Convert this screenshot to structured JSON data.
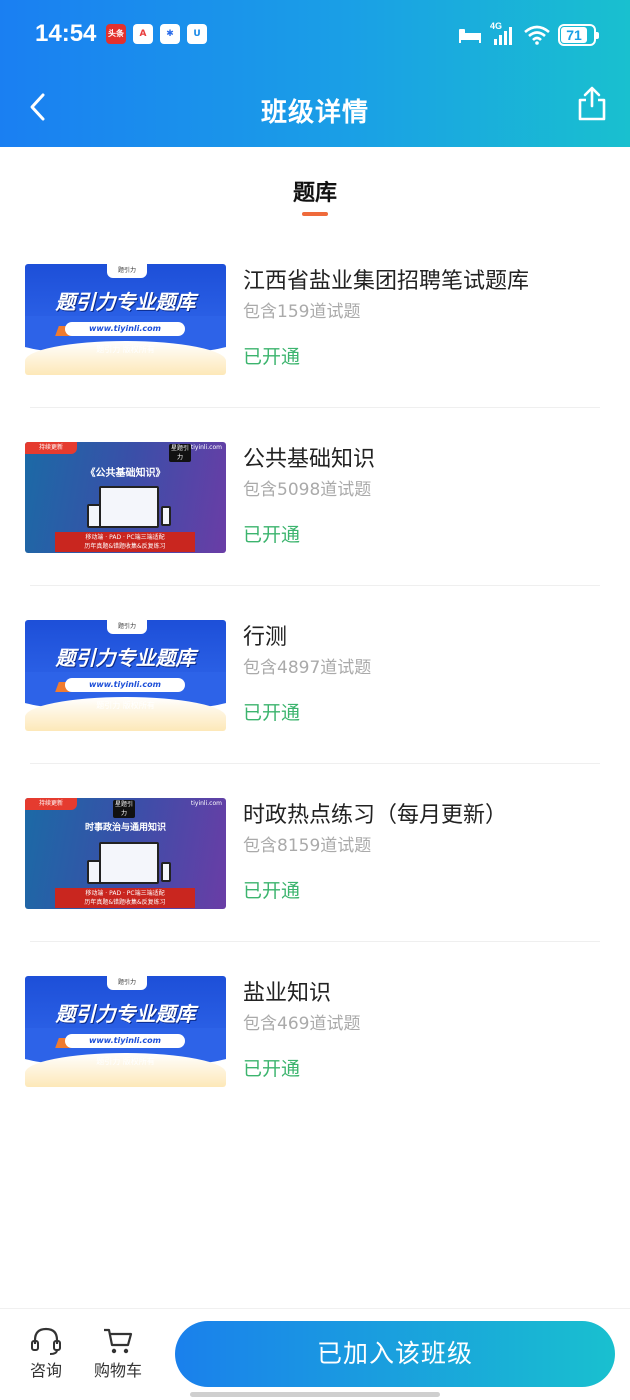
{
  "status_bar": {
    "time": "14:54",
    "app_icons": [
      "toutiao-icon",
      "app-a-icon",
      "app-cube-icon",
      "app-u-icon"
    ],
    "app_labels": [
      "头条",
      "A",
      "✱",
      "U"
    ],
    "network": "4G",
    "battery": "71"
  },
  "nav": {
    "title": "班级详情",
    "back_icon": "chevron-left-icon",
    "share_icon": "share-icon"
  },
  "tabs": [
    {
      "label": "题库",
      "active": true
    }
  ],
  "items": [
    {
      "thumb": "blue",
      "thumb_text": {
        "logo": "题引力",
        "main": "题引力专业题库",
        "url": "www.tiyinli.com",
        "copy": "题引力 版权所有"
      },
      "name": "江西省盐业集团招聘笔试题库",
      "count": "包含159道试题",
      "status": "已开通"
    },
    {
      "thumb": "purple",
      "thumb_text": {
        "tag": "持续更新",
        "brand": "tiyinli.com",
        "badge": "星题引力",
        "heading": "《公共基础知识》",
        "box_line1": "移动端 · PAD · PC端三端适配",
        "box_line2": "历年真题&错题收集&反复练习"
      },
      "name": "公共基础知识",
      "count": "包含5098道试题",
      "status": "已开通"
    },
    {
      "thumb": "blue",
      "thumb_text": {
        "logo": "题引力",
        "main": "题引力专业题库",
        "url": "www.tiyinli.com",
        "copy": "题引力 版权所有"
      },
      "name": "行测",
      "count": "包含4897道试题",
      "status": "已开通"
    },
    {
      "thumb": "purple",
      "thumb_text": {
        "tag": "持续更新",
        "brand": "tiyinli.com",
        "badge": "星题引力",
        "heading": "时事政治与通用知识",
        "box_line1": "移动端 · PAD · PC端三端适配",
        "box_line2": "历年真题&错题收集&反复练习"
      },
      "name": "时政热点练习（每月更新）",
      "count": "包含8159道试题",
      "status": "已开通"
    },
    {
      "thumb": "blue",
      "thumb_text": {
        "logo": "题引力",
        "main": "题引力专业题库",
        "url": "www.tiyinli.com",
        "copy": "题引力 版权所有"
      },
      "name": "盐业知识",
      "count": "包含469道试题",
      "status": "已开通"
    }
  ],
  "footer": {
    "consult_label": "咨询",
    "consult_icon": "headset-icon",
    "cart_label": "购物车",
    "cart_icon": "cart-icon",
    "joined_label": "已加入该班级"
  },
  "colors": {
    "header_start": "#1a7ff2",
    "header_end": "#19c0cf",
    "status_green": "#3cb46e",
    "tab_indicator": "#ef6a3b"
  }
}
